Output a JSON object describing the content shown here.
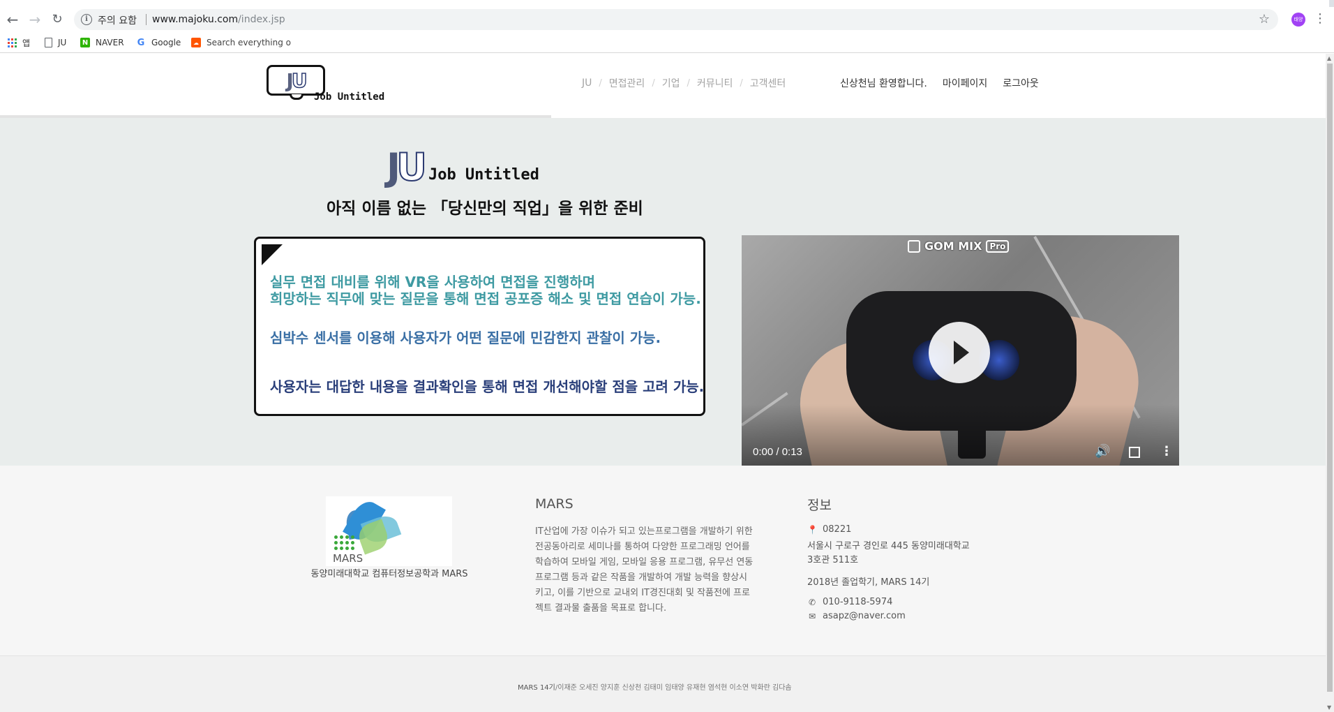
{
  "browser": {
    "security_label": "주의 요함",
    "url_host": "www.majoku.com",
    "url_path": "/index.jsp",
    "profile_initial": "태양",
    "bookmarks": [
      {
        "label": "앱",
        "icon": "apps-grid-icon"
      },
      {
        "label": "JU",
        "icon": "page-icon"
      },
      {
        "label": "NAVER",
        "icon": "naver-icon"
      },
      {
        "label": "Google",
        "icon": "google-icon"
      },
      {
        "label": "Search everything o",
        "icon": "soundcloud-icon"
      }
    ]
  },
  "header": {
    "logo_mark": "JU",
    "logo_text": "Job Untitled",
    "nav": [
      "JU",
      "면접관리",
      "기업",
      "커뮤니티",
      "고객센터"
    ],
    "welcome": "신상천님 환영합니다.",
    "mypage": "마이페이지",
    "logout": "로그아웃"
  },
  "hero": {
    "logo_mark": "JU",
    "logo_text": "Job Untitled",
    "tagline": "아직 이름 없는 「당신만의 직업」을 위한 준비",
    "lines": [
      "실무 면접 대비를 위해 VR을 사용하여 면접을 진행하며",
      "희망하는 직무에 맞는 질문을 통해 면접 공포증 해소 및 면접 연습이 가능.",
      "심박수 센서를 이용해 사용자가 어떤 질문에 민감한지 관찰이 가능.",
      "사용자는 대답한 내용을 결과확인을 통해 면접 개선해야할 점을 고려 가능."
    ]
  },
  "video": {
    "watermark": "GOM MIX",
    "watermark_badge": "Pro",
    "time": "0:00 / 0:13",
    "progress": 0.0,
    "buffered": 0.17
  },
  "footer": {
    "mars_wordmark": "MARS",
    "school": "동양미래대학교 컴퓨터정보공학과 MARS",
    "mars_title": "MARS",
    "mars_desc": [
      "IT산업에 가장 이슈가 되고 있는프로그램을 개발하기 위한",
      "전공동아리로 세미나를 통하여 다양한 프로그래밍 언어를",
      "학습하여 모바일 게임, 모바일 응용 프로그램, 유무선 연동",
      "프로그램 등과 같은 작품을 개발하여 개발 능력을 향상시",
      "키고, 이를 기반으로 교내외 IT경진대회 및 작품전에 프로",
      "젝트 결과물 출품을 목표로 합니다."
    ],
    "info_title": "정보",
    "postcode": "08221",
    "address_1": "서울시 구로구 경인로 445 동양미래대학교",
    "address_2": "3호관 511호",
    "term": "2018년 졸업학기, MARS 14기",
    "phone": "010-9118-5974",
    "email": "asapz@naver.com",
    "credits_strong": "MARS 14기",
    "credits_rest": "/이재준 오세진 양지훈 신상천 김태미 임태양 유재현 염석현 이소연 박화란 김다솜"
  },
  "colors": {
    "hero_bg": "#e9edec",
    "footer_bg": "#f6f6f6",
    "teal_text": "#3e9aa2",
    "blue_text": "#3a6fa5",
    "navy_text": "#2a3f7a"
  }
}
